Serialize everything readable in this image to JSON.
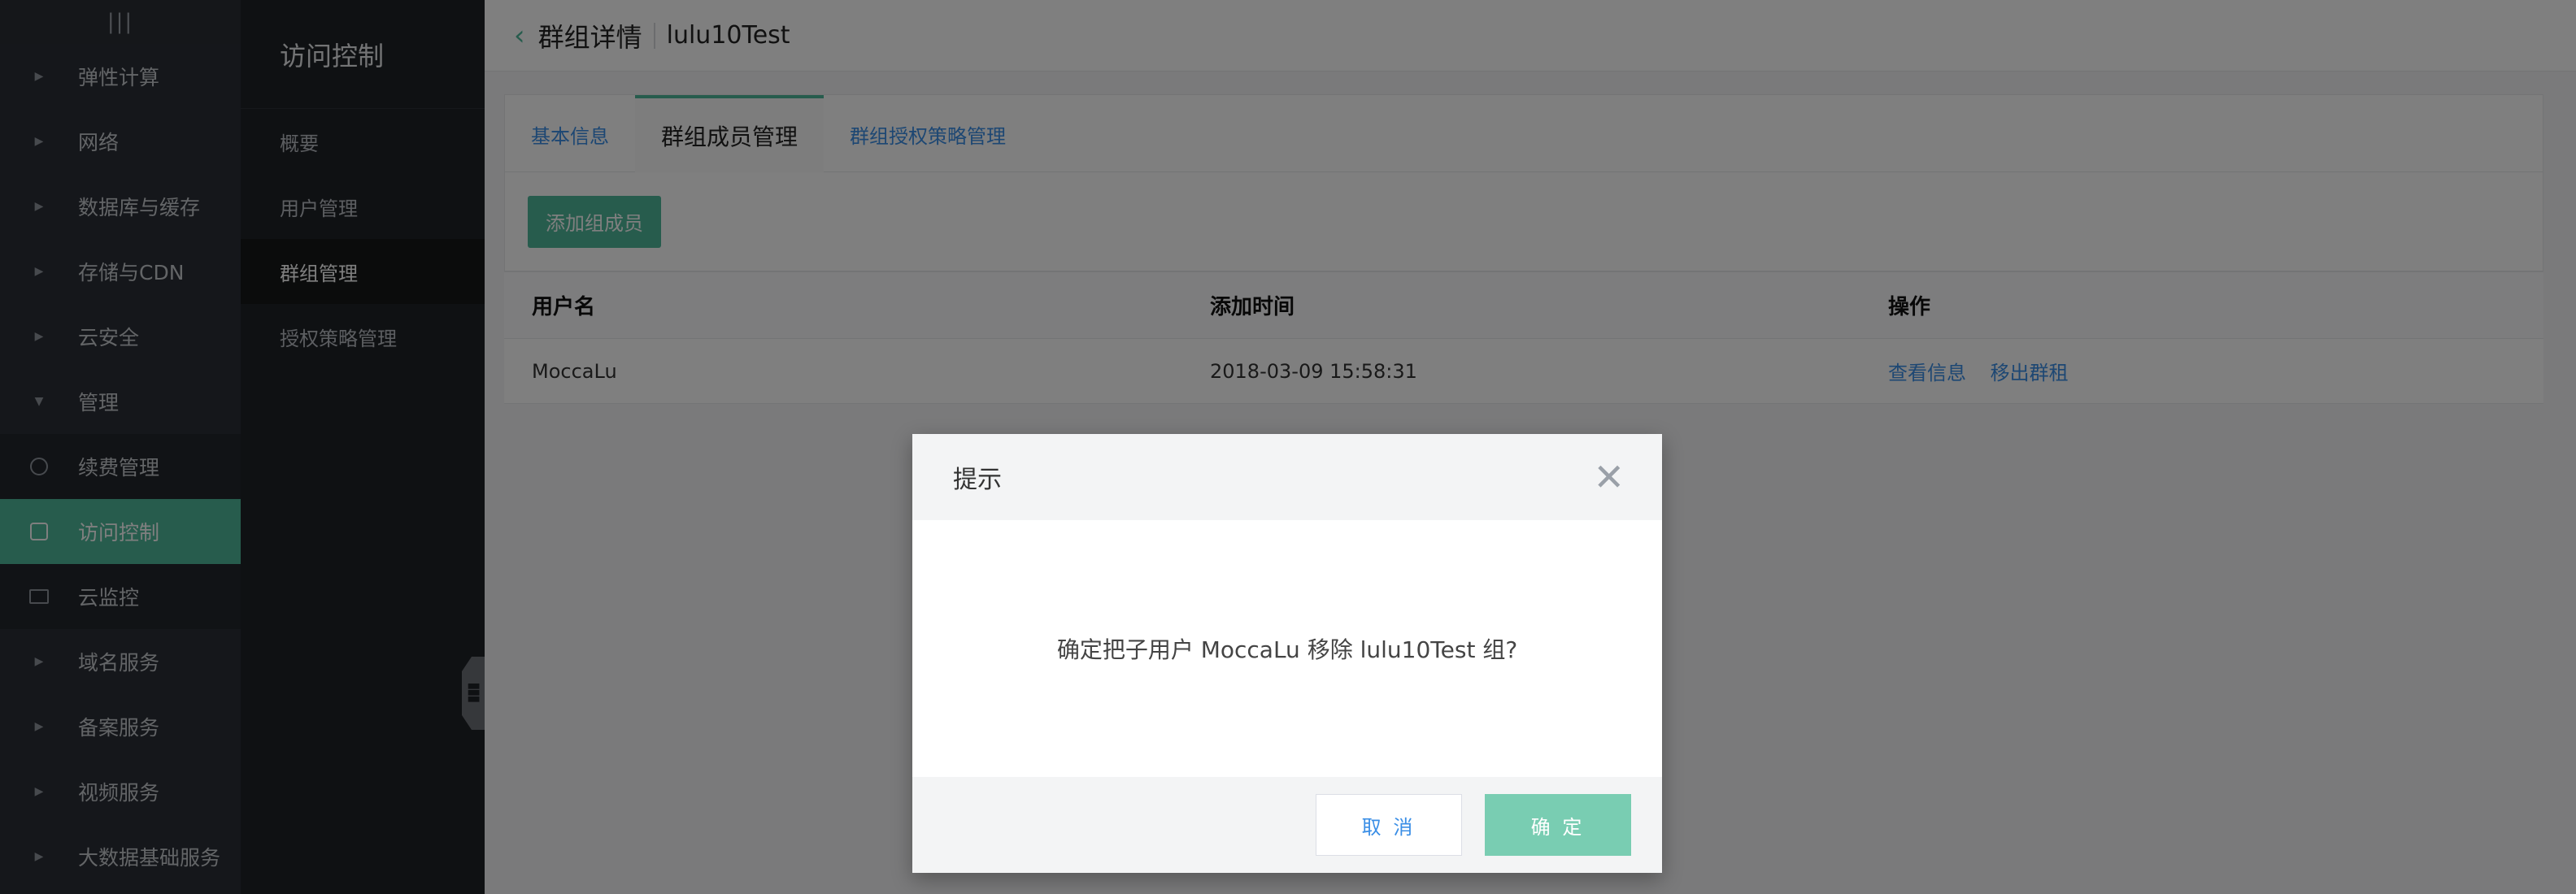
{
  "leftnav": {
    "top_icon": "|||",
    "items": [
      {
        "label": "弹性计算",
        "type": "group",
        "icon": "caret-right-icon"
      },
      {
        "label": "网络",
        "type": "group",
        "icon": "caret-right-icon"
      },
      {
        "label": "数据库与缓存",
        "type": "group",
        "icon": "caret-right-icon"
      },
      {
        "label": "存储与CDN",
        "type": "group",
        "icon": "caret-right-icon"
      },
      {
        "label": "云安全",
        "type": "group",
        "icon": "caret-right-icon"
      },
      {
        "label": "管理",
        "type": "group-open",
        "icon": "caret-down-icon"
      },
      {
        "label": "续费管理",
        "type": "sub",
        "icon": "renew-icon"
      },
      {
        "label": "访问控制",
        "type": "sub-active",
        "icon": "access-control-icon"
      },
      {
        "label": "云监控",
        "type": "sub",
        "icon": "monitor-icon"
      },
      {
        "label": "域名服务",
        "type": "group",
        "icon": "caret-right-icon"
      },
      {
        "label": "备案服务",
        "type": "group",
        "icon": "caret-right-icon"
      },
      {
        "label": "视频服务",
        "type": "group",
        "icon": "caret-right-icon"
      },
      {
        "label": "大数据基础服务",
        "type": "group",
        "icon": "caret-right-icon"
      }
    ]
  },
  "subnav": {
    "title": "访问控制",
    "items": [
      {
        "label": "概要"
      },
      {
        "label": "用户管理"
      },
      {
        "label": "群组管理"
      },
      {
        "label": "授权策略管理"
      }
    ]
  },
  "header": {
    "title": "群组详情",
    "group_name": "lulu10Test"
  },
  "tabs": [
    {
      "label": "基本信息"
    },
    {
      "label": "群组成员管理"
    },
    {
      "label": "群组授权策略管理"
    }
  ],
  "toolbar": {
    "add_member_label": "添加组成员"
  },
  "table": {
    "headers": [
      "用户名",
      "添加时间",
      "操作"
    ],
    "rows": [
      {
        "username": "MoccaLu",
        "added_at": "2018-03-09 15:58:31",
        "actions": [
          "查看信息",
          "移出群租"
        ]
      }
    ]
  },
  "modal": {
    "title": "提示",
    "message": "确定把子用户 MoccaLu 移除 lulu10Test 组?",
    "cancel_label": "取 消",
    "ok_label": "确 定"
  },
  "colors": {
    "accent": "#4eb89a",
    "link": "#3a8ee6",
    "nav_bg": "#2b2f36",
    "subnav_bg": "#1f2226"
  }
}
